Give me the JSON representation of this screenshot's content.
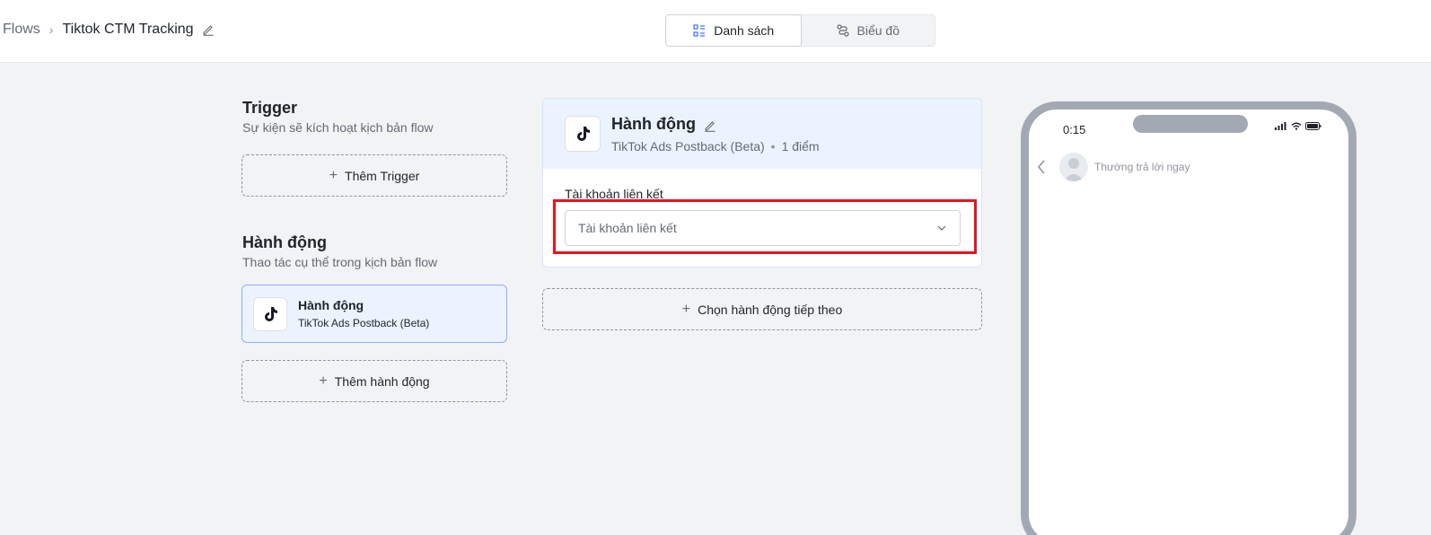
{
  "breadcrumb": {
    "root": "Flows",
    "title": "Tiktok CTM Tracking"
  },
  "view_toggle": {
    "list": "Danh sách",
    "chart": "Biểu đồ"
  },
  "trigger": {
    "title": "Trigger",
    "subtitle": "Sự kiện sẽ kích hoạt kịch bản flow",
    "add_button": "Thêm Trigger"
  },
  "actions": {
    "title": "Hành động",
    "subtitle": "Thao tác cụ thể trong kịch bản flow",
    "items": [
      {
        "name": "Hành động",
        "description": "TikTok Ads Postback (Beta)"
      }
    ],
    "add_button": "Thêm hành động"
  },
  "detail": {
    "title": "Hành động",
    "integration": "TikTok Ads Postback (Beta)",
    "points": "1 điểm",
    "field_label": "Tài khoản liên kết",
    "select_placeholder": "Tài khoản liên kết"
  },
  "next_action_button": "Chọn hành động tiếp theo",
  "phone": {
    "time": "0:15",
    "chat_status": "Thường trả lời ngay"
  },
  "colors": {
    "highlight": "#e8141d",
    "selected_bg": "#ebf3fe",
    "selected_border": "#8db1f5"
  }
}
